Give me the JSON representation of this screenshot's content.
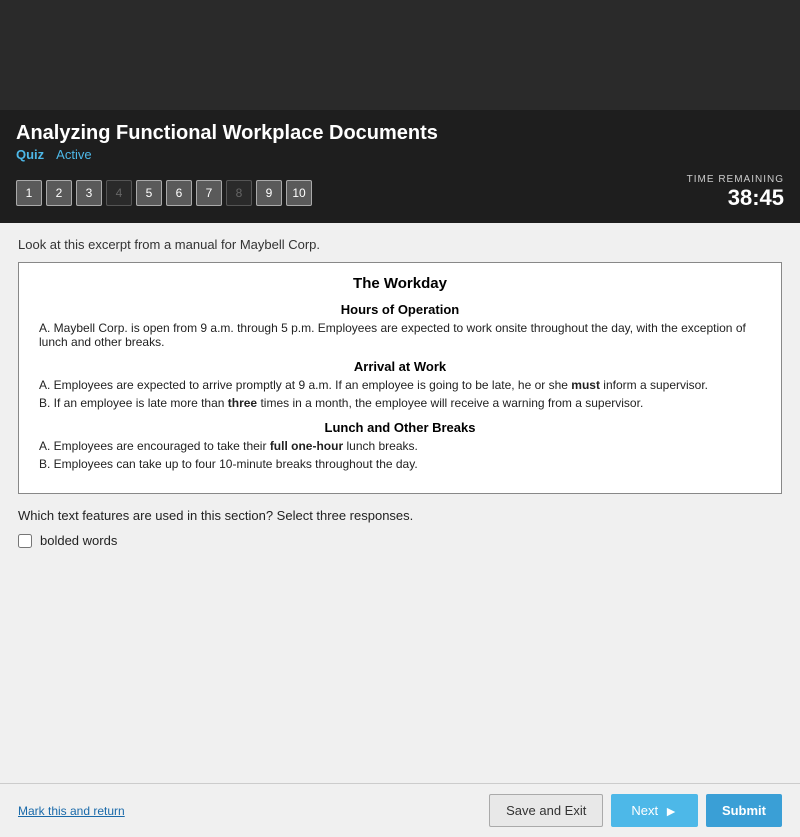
{
  "header": {
    "title": "Analyzing Functional Workplace Documents",
    "quiz_label": "Quiz",
    "status": "Active"
  },
  "timer": {
    "label": "TIME REMAINING",
    "value": "38:45"
  },
  "question_numbers": [
    {
      "num": "1",
      "state": "active"
    },
    {
      "num": "2",
      "state": "active"
    },
    {
      "num": "3",
      "state": "active"
    },
    {
      "num": "4",
      "state": "disabled"
    },
    {
      "num": "5",
      "state": "active"
    },
    {
      "num": "6",
      "state": "active"
    },
    {
      "num": "7",
      "state": "active"
    },
    {
      "num": "8",
      "state": "disabled"
    },
    {
      "num": "9",
      "state": "active"
    },
    {
      "num": "10",
      "state": "active"
    }
  ],
  "excerpt_label": "Look at this excerpt from a manual for Maybell Corp.",
  "document": {
    "main_title": "The Workday",
    "sections": [
      {
        "title": "Hours of Operation",
        "items": [
          {
            "label": "A.",
            "text": "Maybell Corp. is open from 9 a.m. through 5 p.m. Employees are expected to work onsite throughout the day, with the exception of lunch and other breaks."
          }
        ]
      },
      {
        "title": "Arrival at Work",
        "items": [
          {
            "label": "A.",
            "text": "Employees are expected to arrive promptly at 9 a.m. If an employee is going to be late, he or she must inform a supervisor.",
            "bold_word": "must"
          },
          {
            "label": "B.",
            "text": "If an employee is late more than three times in a month, the employee will receive a warning from a supervisor.",
            "bold_word": "three"
          }
        ]
      },
      {
        "title": "Lunch and Other Breaks",
        "items": [
          {
            "label": "A.",
            "text": "Employees are encouraged to take their full one-hour lunch breaks.",
            "bold_phrase": "full one-hour"
          },
          {
            "label": "B.",
            "text": "Employees can take up to four 10-minute breaks throughout the day."
          }
        ]
      }
    ]
  },
  "question": {
    "text": "Which text features are used in this section? Select three responses."
  },
  "answers": [
    {
      "id": "a1",
      "label": "bolded words",
      "checked": false
    }
  ],
  "buttons": {
    "save_exit": "Save and Exit",
    "next": "Next",
    "submit": "Submit"
  },
  "mark_return": "Mark this and return"
}
